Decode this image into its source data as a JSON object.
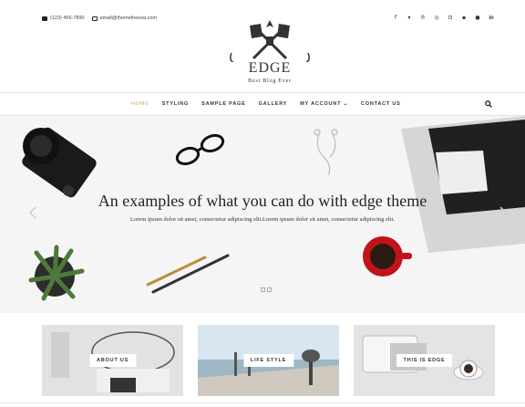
{
  "topbar": {
    "phone": "(123) 456-7890",
    "email": "email@themefreesia.com",
    "social_icons": [
      "facebook-icon",
      "twitter-icon",
      "pinterest-icon",
      "dribbble-icon",
      "instagram-icon",
      "flickr-icon",
      "vimeo-icon",
      "linkedin-icon"
    ]
  },
  "logo": {
    "title": "EDGE",
    "tagline": "Best Blog Ever"
  },
  "nav": {
    "items": [
      {
        "label": "HOME",
        "active": true
      },
      {
        "label": "STYLING"
      },
      {
        "label": "SAMPLE PAGE"
      },
      {
        "label": "GALLERY"
      },
      {
        "label": "MY ACCOUNT ⌄"
      },
      {
        "label": "CONTACT US"
      }
    ]
  },
  "slider": {
    "title": "An examples of what you can do with edge theme",
    "text": "Lorem ipsum dolor sit amet, consectetur adipiscing elit.Lorem ipsum dolor sit amet, consectetur adipiscing elit."
  },
  "promos": [
    {
      "label": "ABOUT US"
    },
    {
      "label": "LIFE STYLE"
    },
    {
      "label": "THIS IS EDGE"
    }
  ],
  "colors": {
    "accent": "#c9a84f",
    "text": "#333333"
  }
}
